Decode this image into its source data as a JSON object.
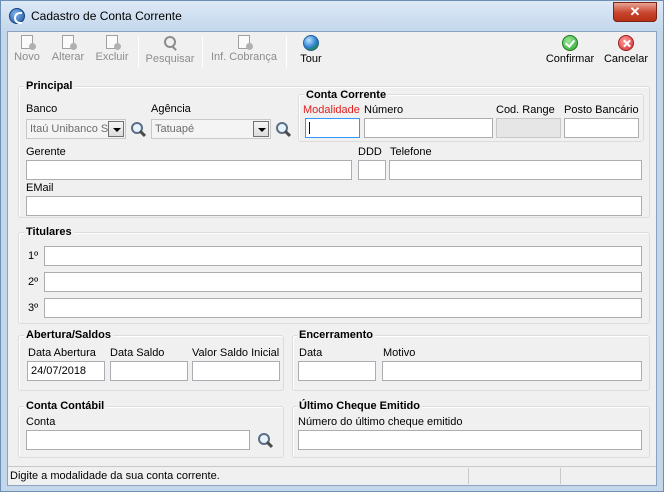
{
  "window": {
    "title": "Cadastro de Conta Corrente",
    "close_label": "✕"
  },
  "toolbar": {
    "novo": "Novo",
    "alterar": "Alterar",
    "excluir": "Excluir",
    "pesquisar": "Pesquisar",
    "inf_cobranca": "Inf. Cobrança",
    "tour": "Tour",
    "confirmar": "Confirmar",
    "cancelar": "Cancelar"
  },
  "principal": {
    "title": "Principal",
    "banco_label": "Banco",
    "banco_value": "Itaú Unibanco S",
    "agencia_label": "Agência",
    "agencia_value": "Tatuapé",
    "gerente_label": "Gerente",
    "gerente_value": "",
    "ddd_label": "DDD",
    "ddd_value": "",
    "telefone_label": "Telefone",
    "telefone_value": "",
    "email_label": "EMail",
    "email_value": ""
  },
  "conta_corrente": {
    "title": "Conta Corrente",
    "modalidade_label": "Modalidade",
    "modalidade_value": "",
    "numero_label": "Número",
    "numero_value": "",
    "cod_range_label": "Cod. Range",
    "cod_range_value": "",
    "posto_label": "Posto Bancário",
    "posto_value": ""
  },
  "titulares": {
    "title": "Titulares",
    "rows": [
      {
        "label": "1º",
        "value": ""
      },
      {
        "label": "2º",
        "value": ""
      },
      {
        "label": "3º",
        "value": ""
      }
    ]
  },
  "abertura": {
    "title": "Abertura/Saldos",
    "data_abertura_label": "Data Abertura",
    "data_abertura_value": "24/07/2018",
    "data_saldo_label": "Data Saldo",
    "data_saldo_value": "",
    "valor_saldo_label": "Valor Saldo Inicial",
    "valor_saldo_value": ""
  },
  "encerramento": {
    "title": "Encerramento",
    "data_label": "Data",
    "data_value": "",
    "motivo_label": "Motivo",
    "motivo_value": ""
  },
  "conta_contabil": {
    "title": "Conta Contábil",
    "conta_label": "Conta",
    "conta_value": ""
  },
  "ultimo_cheque": {
    "title": "Último Cheque Emitido",
    "numero_label": "Número do último cheque emitido",
    "numero_value": ""
  },
  "status": {
    "text": "Digite a modalidade da sua conta corrente."
  },
  "colors": {
    "required_label": "#e02020",
    "focus_border": "#3399ff"
  },
  "icons": [
    "app-icon",
    "new-icon",
    "edit-icon",
    "delete-icon",
    "search-icon",
    "billing-icon",
    "globe-icon",
    "check-icon",
    "cancel-icon",
    "close-icon",
    "chevron-down-icon"
  ]
}
